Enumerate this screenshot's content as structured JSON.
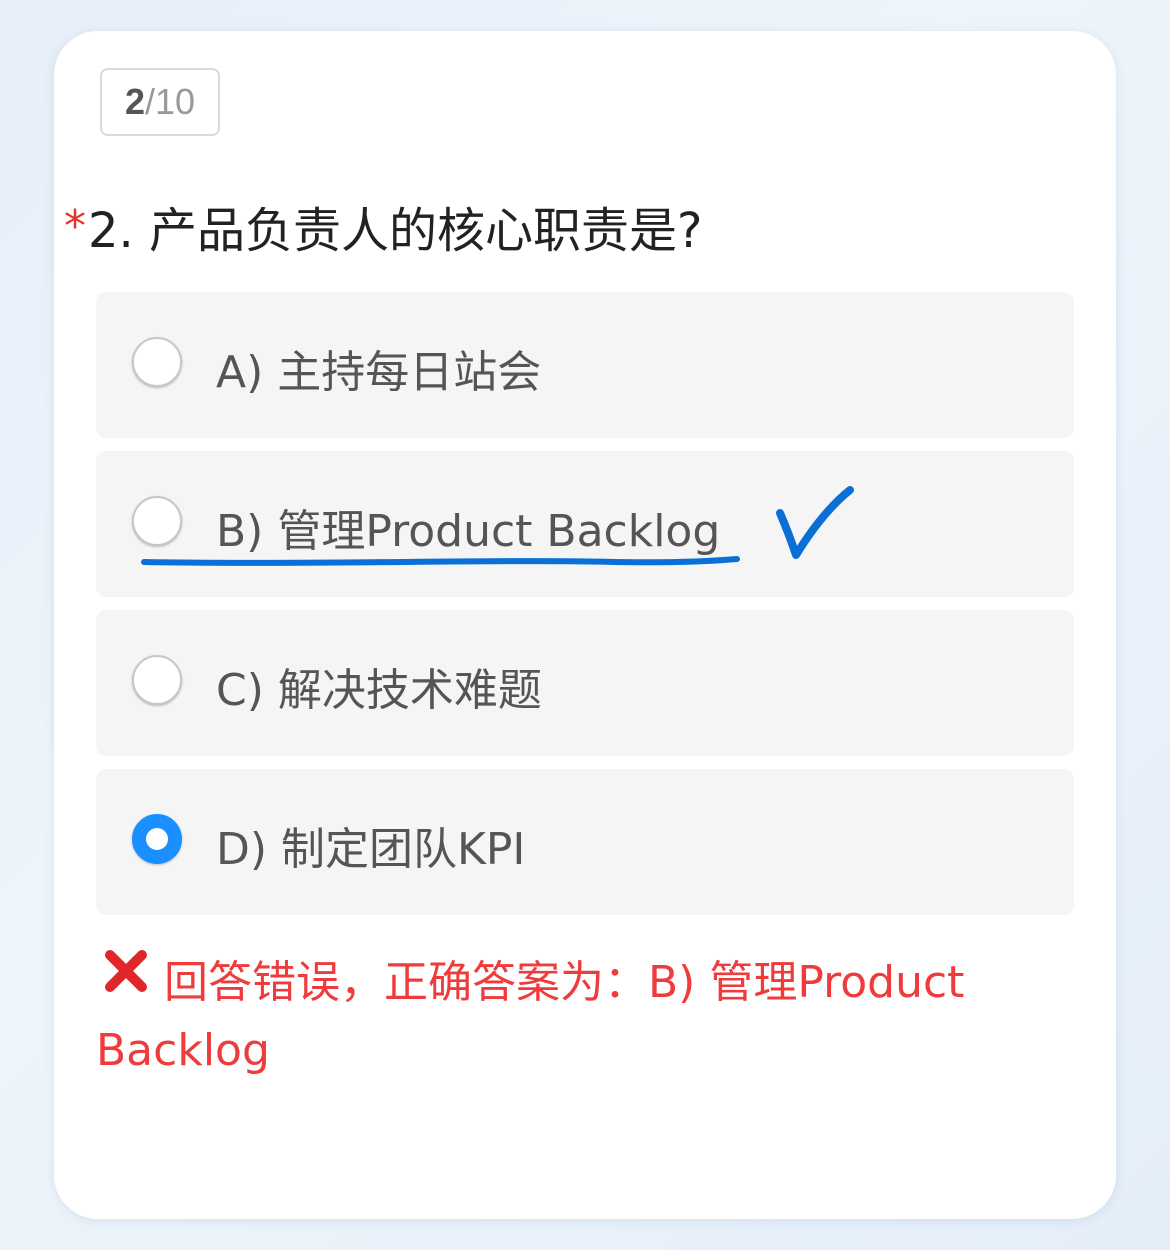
{
  "progress": {
    "current": "2",
    "separator": "/",
    "total": "10"
  },
  "question": {
    "required_mark": "*",
    "text": "2. 产品负责人的核心职责是?"
  },
  "options": [
    {
      "label": "A) 主持每日站会",
      "selected": false
    },
    {
      "label": "B) 管理Product Backlog",
      "selected": false
    },
    {
      "label": "C) 解决技术难题",
      "selected": false
    },
    {
      "label": "D) 制定团队KPI",
      "selected": true
    }
  ],
  "feedback": {
    "icon": "cross-mark-icon",
    "text": "回答错误，正确答案为：B) 管理Product Backlog"
  },
  "annotation": {
    "color": "#0a6fd6",
    "marks": [
      "underline",
      "check-mark-icon"
    ]
  },
  "colors": {
    "accent": "#1a8fff",
    "error": "#ef3b3b",
    "required": "#e5322d"
  }
}
